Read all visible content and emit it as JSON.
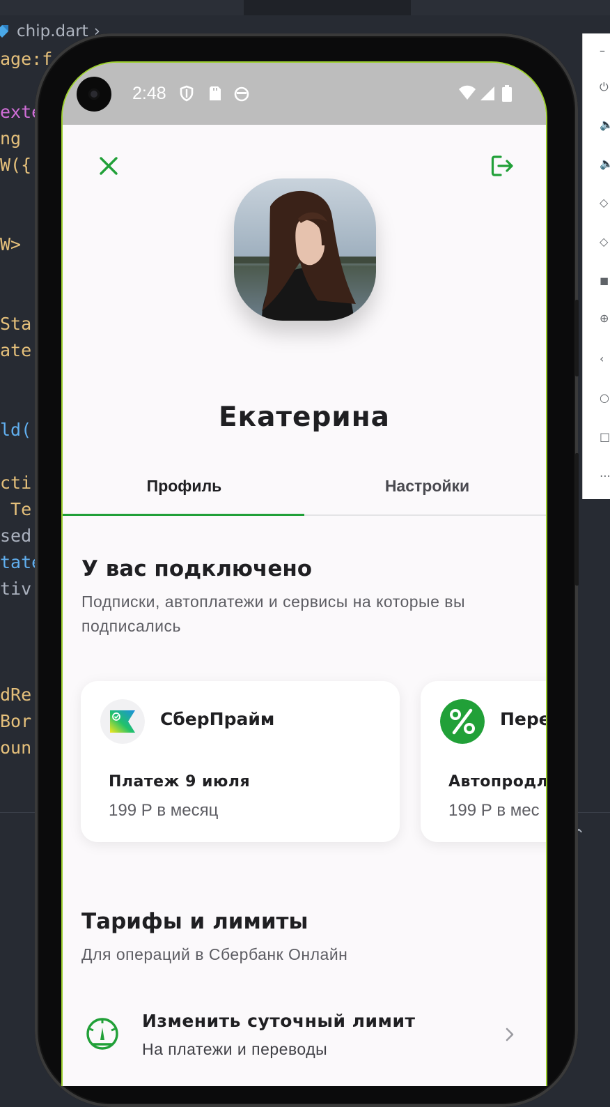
{
  "ide": {
    "breadcrumb_file": "chip.dart",
    "code_fragments": [
      "age:f",
      "exte",
      "ng ",
      "W({",
      "W> ",
      "Sta",
      "ate",
      "ld(",
      "cti",
      " Te",
      "sed",
      "tate",
      "tiv",
      "dRe",
      "Bor",
      "oun"
    ]
  },
  "status_bar": {
    "time": "2:48"
  },
  "header": {
    "close_icon": "close-icon",
    "logout_icon": "logout-icon"
  },
  "profile": {
    "name": "Екатерина"
  },
  "tabs": [
    {
      "label": "Профиль",
      "active": true
    },
    {
      "label": "Настройки",
      "active": false
    }
  ],
  "connected": {
    "title": "У вас подключено",
    "subtitle_line1": "Подписки, автоплатежи и сервисы на которые вы",
    "subtitle_line2": "подписались",
    "cards": [
      {
        "title": "СберПрайм",
        "line1": "Платеж 9 июля",
        "line2": "199 Р в месяц",
        "icon": "sberprime-logo"
      },
      {
        "title": "Пере",
        "line1": "Автопродл",
        "line2": "199 Р в мес",
        "icon": "percent-icon"
      }
    ]
  },
  "tariffs": {
    "title": "Тарифы и лимиты",
    "subtitle": "Для операций в Сбербанк Онлайн",
    "rows": [
      {
        "title": "Изменить суточный лимит",
        "subtitle": "На платежи и переводы",
        "icon": "speedometer-icon"
      }
    ]
  },
  "colors": {
    "accent": "#21a038",
    "text_primary": "#1f1f22",
    "text_secondary": "#5d5d63",
    "background": "#fbf9fb"
  }
}
